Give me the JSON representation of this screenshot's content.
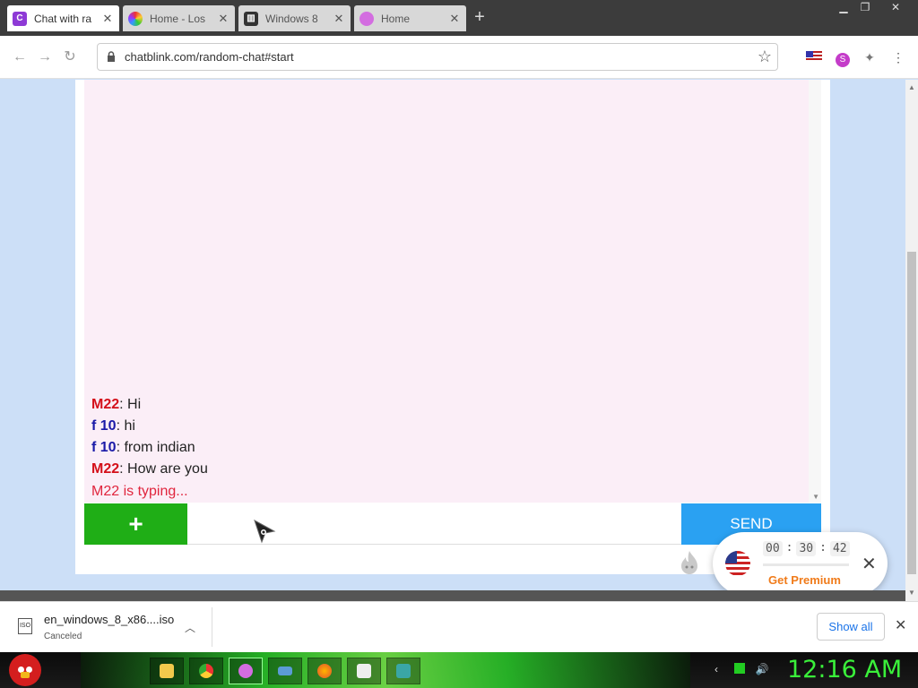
{
  "browser": {
    "tabs": [
      {
        "title": "Chat with ra",
        "active": true,
        "favicon": "chatblink-icon"
      },
      {
        "title": "Home - Los",
        "active": false,
        "favicon": "colorful-wheel-icon"
      },
      {
        "title": "Windows 8",
        "active": false,
        "favicon": "archive-icon"
      },
      {
        "title": "Home",
        "active": false,
        "favicon": "chatblink-home-icon"
      }
    ],
    "url": "chatblink.com/random-chat#start"
  },
  "chat": {
    "messages": [
      {
        "nick": "M22",
        "gender": "m",
        "text": ": Hi"
      },
      {
        "nick": "f 10",
        "gender": "f",
        "text": ": hi"
      },
      {
        "nick": "f 10",
        "gender": "f",
        "text": ": from indian"
      },
      {
        "nick": "M22",
        "gender": "m",
        "text": ": How are you"
      }
    ],
    "typing": "M22 is typing...",
    "add_label": "+",
    "send_label": "SEND",
    "input_value": ""
  },
  "premium": {
    "timer": {
      "h": "00",
      "m": "30",
      "s": "42"
    },
    "label": "Get Premium"
  },
  "downloads": {
    "file": "en_windows_8_x86....iso",
    "status": "Canceled",
    "icon_text": "ISO",
    "show_all": "Show all"
  },
  "taskbar": {
    "clock": "12:16 AM"
  },
  "colors": {
    "male": "#d4101a",
    "female": "#1a1aa8",
    "add": "#1fae16",
    "send": "#2aa1f2",
    "premium": "#f07b1a",
    "clock": "#3af03a"
  }
}
